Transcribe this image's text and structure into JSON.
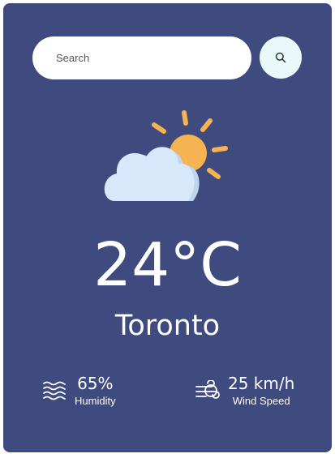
{
  "search": {
    "placeholder": "Search",
    "button_icon": "search-icon"
  },
  "weather": {
    "icon": "partly-cloudy-icon",
    "temperature": "24°C",
    "city": "Toronto"
  },
  "details": {
    "humidity": {
      "icon": "humidity-waves-icon",
      "value": "65%",
      "label": "Humidity"
    },
    "wind": {
      "icon": "wind-icon",
      "value": "25 km/h",
      "label": "Wind Speed"
    }
  },
  "colors": {
    "card_background": "#3f4a7e",
    "search_button_background": "#e9f8f8",
    "sun": "#f5b352",
    "cloud": "#cfe4f7"
  }
}
